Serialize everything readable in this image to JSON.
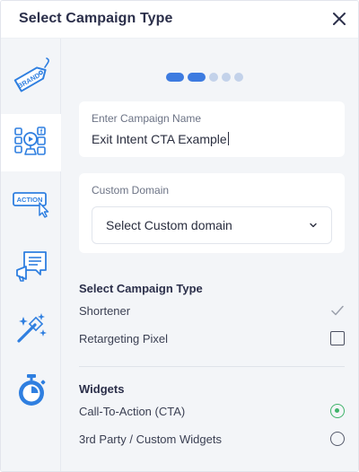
{
  "header": {
    "title": "Select Campaign Type",
    "close_icon": "close-icon"
  },
  "sidebar": {
    "items": [
      {
        "icon": "brand-tag-icon",
        "tag_text": "BRAND",
        "active": false
      },
      {
        "icon": "social-icons-icon",
        "active": true
      },
      {
        "icon": "action-button-icon",
        "tag_text": "ACTION",
        "active": false
      },
      {
        "icon": "announcement-chat-icon",
        "active": false
      },
      {
        "icon": "magic-wand-icon",
        "active": false
      },
      {
        "icon": "stopwatch-icon",
        "active": false
      }
    ]
  },
  "stepper": {
    "total_steps": 5,
    "completed_steps": 2
  },
  "campaign_name": {
    "label": "Enter Campaign Name",
    "value": "Exit Intent CTA Example"
  },
  "custom_domain": {
    "label": "Custom Domain",
    "selected": "Select Custom domain"
  },
  "campaign_type": {
    "title": "Select Campaign Type",
    "options": [
      {
        "label": "Shortener",
        "control": "check",
        "state": "checked"
      },
      {
        "label": "Retargeting Pixel",
        "control": "checkbox",
        "state": "unchecked"
      }
    ]
  },
  "widgets": {
    "title": "Widgets",
    "options": [
      {
        "label": "Call-To-Action (CTA)",
        "control": "radio",
        "state": "checked"
      },
      {
        "label": "3rd Party / Custom Widgets",
        "control": "radio",
        "state": "unchecked"
      }
    ]
  },
  "colors": {
    "accent": "#3d7be0",
    "icon_blue": "#2f7fe0",
    "success_green": "#3fb36a",
    "title_text": "#2b2f4a",
    "panel_bg": "#f3f5f8"
  }
}
